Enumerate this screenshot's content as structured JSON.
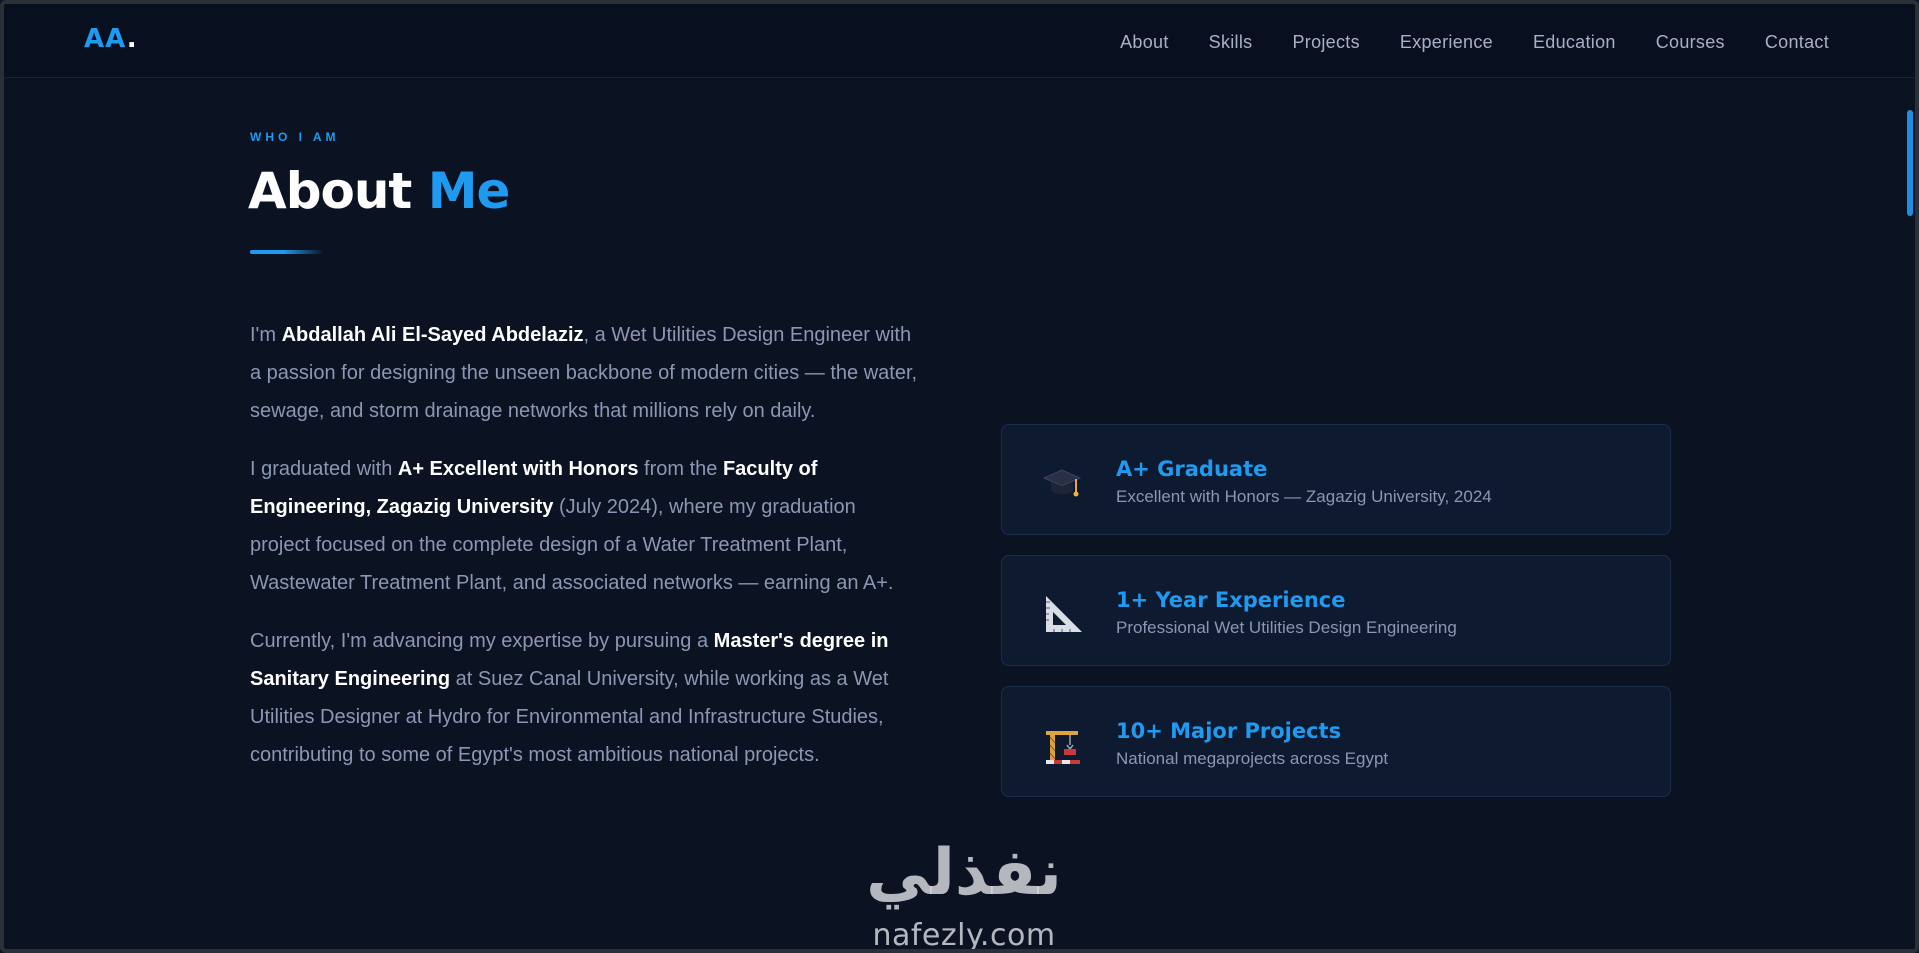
{
  "nav": {
    "logo_main": "AA",
    "logo_dot": ".",
    "links": [
      "About",
      "Skills",
      "Projects",
      "Experience",
      "Education",
      "Courses",
      "Contact"
    ]
  },
  "section": {
    "eyebrow": "WHO I AM",
    "title_main": "About ",
    "title_accent": "Me"
  },
  "bio": {
    "p1": [
      {
        "t": "I'm ",
        "b": false
      },
      {
        "t": "Abdallah Ali El-Sayed Abdelaziz",
        "b": true
      },
      {
        "t": ", a Wet Utilities Design Engineer with a passion for designing the unseen backbone of modern cities — the water, sewage, and storm drainage networks that millions rely on daily.",
        "b": false
      }
    ],
    "p2": [
      {
        "t": "I graduated with ",
        "b": false
      },
      {
        "t": "A+ Excellent with Honors",
        "b": true
      },
      {
        "t": " from the ",
        "b": false
      },
      {
        "t": "Faculty of Engineering, Zagazig University",
        "b": true
      },
      {
        "t": " (July 2024), where my graduation project focused on the complete design of a Water Treatment Plant, Wastewater Treatment Plant, and associated networks — earning an A+.",
        "b": false
      }
    ],
    "p3": [
      {
        "t": "Currently, I'm advancing my expertise by pursuing a ",
        "b": false
      },
      {
        "t": "Master's degree in Sanitary Engineering",
        "b": true
      },
      {
        "t": " at Suez Canal University, while working as a Wet Utilities Designer at Hydro for Environmental and Infrastructure Studies, contributing to some of Egypt's most ambitious national projects.",
        "b": false
      }
    ]
  },
  "cards": [
    {
      "icon": "graduation-cap-icon",
      "title": "A+ Graduate",
      "subtitle": "Excellent with Honors — Zagazig University, 2024"
    },
    {
      "icon": "triangle-ruler-icon",
      "title": "1+ Year Experience",
      "subtitle": "Professional Wet Utilities Design Engineering"
    },
    {
      "icon": "construction-crane-icon",
      "title": "10+ Major Projects",
      "subtitle": "National megaprojects across Egypt"
    }
  ],
  "colors": {
    "accent": "#1e9bf0",
    "background": "#0b1222",
    "card": "#0e1a30",
    "text": "#8b97b3",
    "strong": "#ffffff"
  },
  "watermark": {
    "arabic": "نفذلي",
    "latin": "nafezly.com"
  }
}
